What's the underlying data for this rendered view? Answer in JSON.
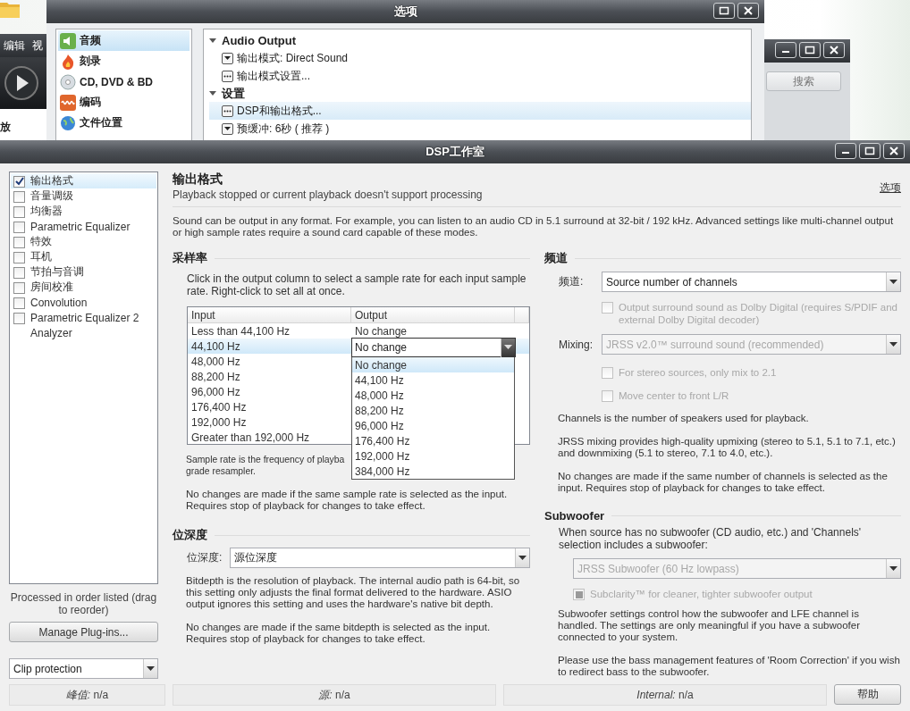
{
  "player": {
    "menu": [
      "编辑",
      "视"
    ],
    "status_text": "放",
    "search_button": "搜索"
  },
  "options_window": {
    "title": "选项",
    "sidebar": [
      {
        "label": "音频",
        "selected": true
      },
      {
        "label": "刻录",
        "selected": false
      },
      {
        "label": "CD, DVD & BD",
        "selected": false
      },
      {
        "label": "编码",
        "selected": false
      },
      {
        "label": "文件位置",
        "selected": false
      }
    ],
    "groups": [
      {
        "title": "Audio Output",
        "expanded": true,
        "items": [
          {
            "kind": "dropdown",
            "label": "输出模式: Direct Sound",
            "selected": false
          },
          {
            "kind": "button",
            "label": "输出模式设置...",
            "selected": false
          }
        ]
      },
      {
        "title": "设置",
        "expanded": true,
        "items": [
          {
            "kind": "button",
            "label": "DSP和输出格式...",
            "selected": true
          },
          {
            "kind": "dropdown",
            "label": "预缓冲: 6秒 ( 推荐 )",
            "selected": false
          }
        ]
      }
    ]
  },
  "dsp_window": {
    "title": "DSP工作室",
    "plugins": [
      {
        "kind": "checkbox",
        "label": "输出格式",
        "checked": true,
        "selected": true
      },
      {
        "kind": "checkbox",
        "label": "音量调级",
        "checked": false,
        "selected": false
      },
      {
        "kind": "checkbox",
        "label": "均衡器",
        "checked": false,
        "selected": false
      },
      {
        "kind": "checkbox",
        "label": "Parametric Equalizer",
        "checked": false,
        "selected": false
      },
      {
        "kind": "checkbox",
        "label": "特效",
        "checked": false,
        "selected": false
      },
      {
        "kind": "checkbox",
        "label": "耳机",
        "checked": false,
        "selected": false
      },
      {
        "kind": "checkbox",
        "label": "节拍与音调",
        "checked": false,
        "selected": false
      },
      {
        "kind": "checkbox",
        "label": "房间校准",
        "checked": false,
        "selected": false
      },
      {
        "kind": "checkbox",
        "label": "Convolution",
        "checked": false,
        "selected": false
      },
      {
        "kind": "checkbox",
        "label": "Parametric Equalizer 2",
        "checked": false,
        "selected": false
      },
      {
        "kind": "plain",
        "label": "Analyzer",
        "selected": false
      }
    ],
    "order_note": "Processed in order listed (drag to reorder)",
    "manage_button": "Manage Plug-ins...",
    "clip_protection": "Clip protection",
    "status": [
      {
        "label": "峰值:",
        "value": "n/a"
      },
      {
        "label": "源:",
        "value": "n/a"
      },
      {
        "label": "Internal:",
        "value": "n/a"
      }
    ],
    "help_button": "帮助",
    "page": {
      "title": "输出格式",
      "subtitle": "Playback stopped or current playback doesn't support processing",
      "options_link": "选项",
      "intro": "Sound can be output in any format.  For example, you can listen to an audio CD in 5.1 surround at 32-bit / 192 kHz.  Advanced settings like multi-channel output or high sample rates require a sound card capable of these modes."
    },
    "sample_rate": {
      "title": "采样率",
      "instructions": "Click in the output column to select a sample rate for each input sample rate.  Right-click to set all at once.",
      "columns": [
        "Input",
        "Output"
      ],
      "rows": [
        {
          "input": "Less than 44,100 Hz",
          "output": "No change",
          "selected": false
        },
        {
          "input": "44,100 Hz",
          "selected": true
        },
        {
          "input": "48,000 Hz",
          "selected": false
        },
        {
          "input": "88,200 Hz",
          "selected": false
        },
        {
          "input": "96,000 Hz",
          "selected": false
        },
        {
          "input": "176,400 Hz",
          "selected": false
        },
        {
          "input": "192,000 Hz",
          "selected": false
        },
        {
          "input": "Greater than 192,000 Hz",
          "selected": false
        }
      ],
      "editor": {
        "value": "No change",
        "options": [
          {
            "label": "No change",
            "selected": true
          },
          {
            "label": "44,100 Hz",
            "selected": false
          },
          {
            "label": "48,000 Hz",
            "selected": false
          },
          {
            "label": "88,200 Hz",
            "selected": false
          },
          {
            "label": "96,000 Hz",
            "selected": false
          },
          {
            "label": "176,400 Hz",
            "selected": false
          },
          {
            "label": "192,000 Hz",
            "selected": false
          },
          {
            "label": "384,000 Hz",
            "selected": false
          }
        ]
      },
      "note_lines": [
        "Sample rate is the frequency of playba",
        "grade resampler."
      ],
      "note": "No changes are made if the same sample rate is selected as the input.  Requires stop of playback for changes to take effect."
    },
    "bit_depth": {
      "title": "位深度",
      "label": "位深度:",
      "value": "源位深度",
      "notes": [
        "Bitdepth is the resolution of playback.  The internal audio path is 64-bit, so this setting only adjusts the final format delivered to the hardware.  ASIO output ignores this setting and uses the hardware's native bit depth.",
        "No changes are made if the same bitdepth is selected as the input.  Requires stop of playback for changes to take effect."
      ]
    },
    "channels": {
      "title": "频道",
      "label": "频道:",
      "value": "Source number of channels",
      "options": [
        {
          "label": "Output surround sound as Dolby Digital (requires S/PDIF and external Dolby Digital decoder)",
          "checked": false,
          "disabled": true
        }
      ],
      "mixing": {
        "label": "Mixing:",
        "value": "JRSS v2.0™ surround sound (recommended)",
        "disabled": true
      },
      "mixing_options": [
        {
          "label": "For stereo sources, only mix to 2.1",
          "checked": false,
          "disabled": true
        },
        {
          "label": "Move center to front L/R",
          "checked": false,
          "disabled": true
        }
      ],
      "notes": [
        "Channels is the number of speakers used for playback.",
        "JRSS mixing provides high-quality upmixing (stereo to 5.1, 5.1 to 7.1, etc.) and downmixing (5.1 to stereo, 7.1 to 4.0, etc.).",
        "No changes are made if the same number of channels is selected as the input.  Requires stop of playback for changes to take effect."
      ]
    },
    "subwoofer": {
      "title": "Subwoofer",
      "prompt": "When source has no subwoofer (CD audio, etc.) and 'Channels' selection includes a subwoofer:",
      "value": "JRSS Subwoofer (60 Hz lowpass)",
      "disabled": true,
      "option": {
        "label": "Subclarity™ for cleaner, tighter subwoofer output",
        "checked": true,
        "disabled": true
      },
      "notes": [
        "Subwoofer settings control how the subwoofer and LFE channel is handled.  The settings are only meaningful if you have a subwoofer connected to your system.",
        "Please use the bass management features of 'Room Correction' if you wish to redirect bass to the subwoofer."
      ]
    }
  }
}
